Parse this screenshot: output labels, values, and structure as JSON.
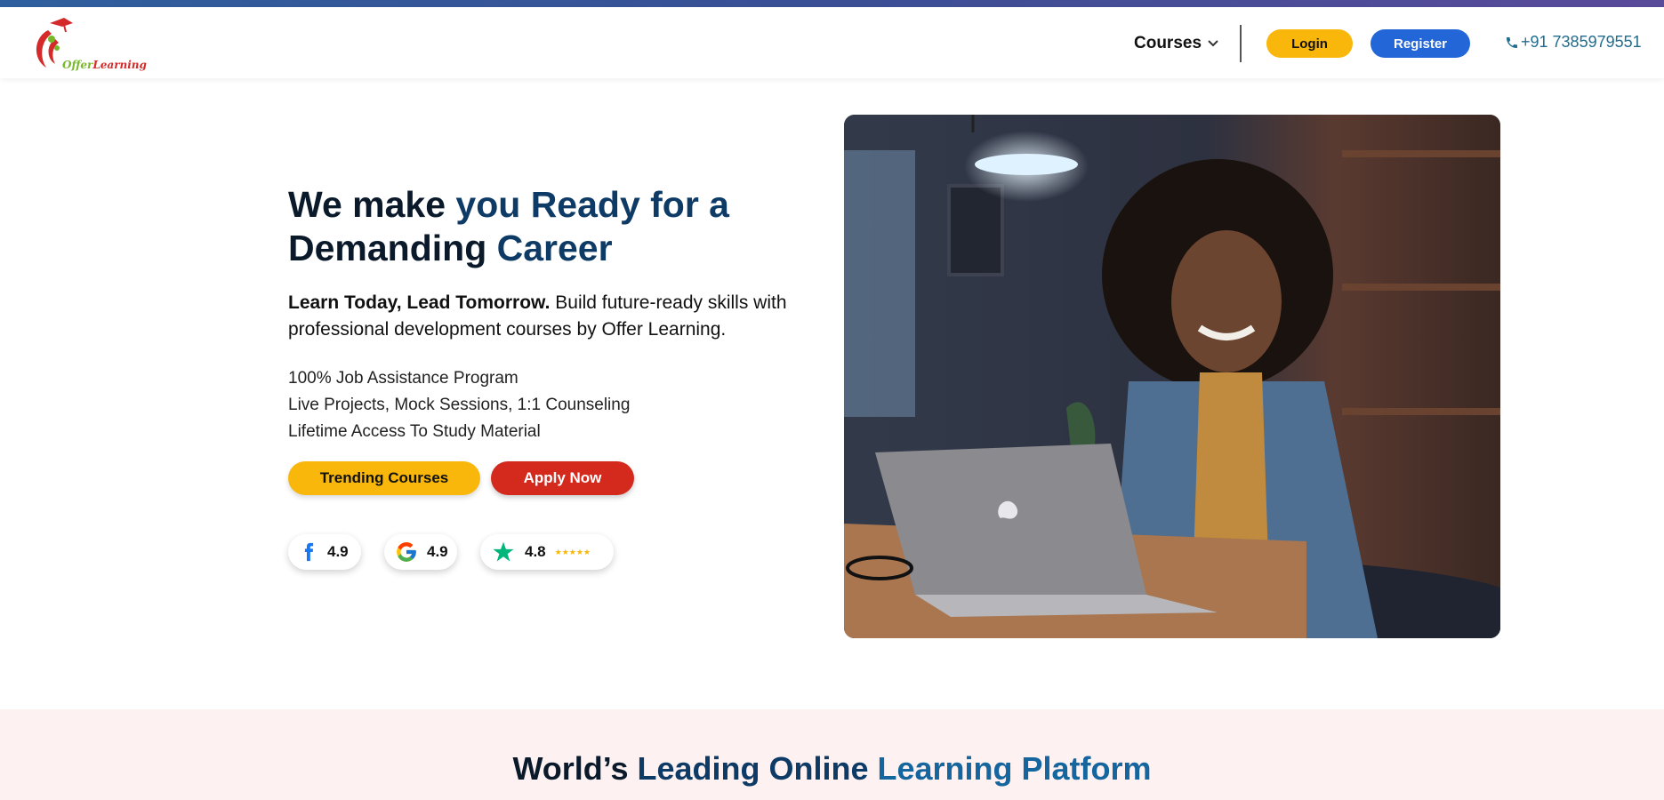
{
  "brand": {
    "logo_text_part1": "Offer",
    "logo_text_part2": "Learning",
    "colors": {
      "yellow": "#f8b70a",
      "blue": "#2366d8",
      "red": "#d42a1e",
      "navy": "#0e3a66",
      "teal": "#1f6c8f"
    }
  },
  "nav": {
    "courses_label": "Courses",
    "courses_icon": "chevron-down-icon",
    "login_label": "Login",
    "register_label": "Register",
    "phone_icon": "phone-icon",
    "phone": "+91 7385979551"
  },
  "hero": {
    "title_part1": "We make ",
    "title_part2": "you Ready for a",
    "title_part3": "Demanding ",
    "title_part4": "Career",
    "subtitle_bold": "Learn Today, Lead Tomorrow.",
    "subtitle_rest": " Build future-ready skills with professional development courses by Offer Learning.",
    "features": [
      "100% Job Assistance Program",
      "Live Projects, Mock Sessions, 1:1 Counseling",
      "Lifetime Access To Study Material"
    ],
    "trending_label": "Trending Courses",
    "apply_label": "Apply Now",
    "ratings": [
      {
        "source_icon": "facebook-icon",
        "score": "4.9"
      },
      {
        "source_icon": "google-icon",
        "score": "4.9"
      },
      {
        "source_icon": "trustpilot-icon",
        "score": "4.8",
        "stars": "★★★★★"
      }
    ],
    "photo_icon": "hero-photo"
  },
  "section2": {
    "title_part1": "World’s ",
    "title_part2": "Leading Online ",
    "title_part3": "Learning Platform"
  }
}
